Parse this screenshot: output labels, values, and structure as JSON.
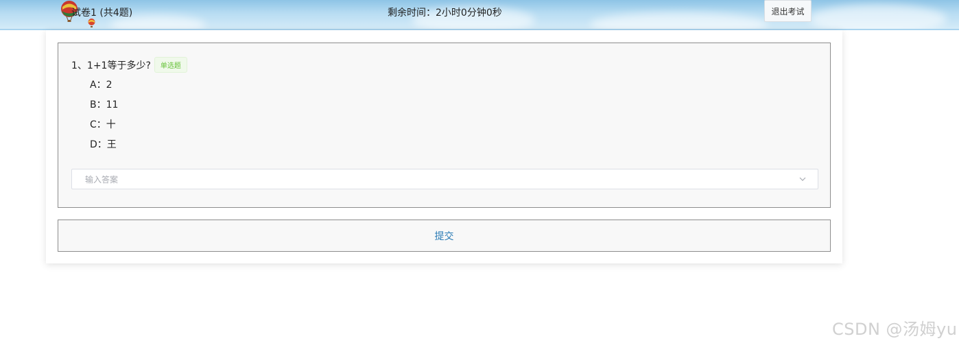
{
  "header": {
    "exam_title": "试卷1 (共4题)",
    "timer": "剩余时间：2小时0分钟0秒",
    "exit_label": "退出考试"
  },
  "question": {
    "text": "1、1+1等于多少?",
    "type_tag": "单选题",
    "options": [
      {
        "label": "A：2"
      },
      {
        "label": "B：11"
      },
      {
        "label": "C：十"
      },
      {
        "label": "D：王"
      }
    ],
    "answer_placeholder": "输入答案"
  },
  "submit": {
    "label": "提交"
  },
  "watermark": "CSDN @汤姆yu",
  "colors": {
    "header_sky": "#b7dcf2",
    "tag_green": "#67c23a",
    "submit_blue": "#2a7bb5"
  },
  "icons": [
    "hot-air-balloon-icon",
    "chevron-down-icon"
  ]
}
